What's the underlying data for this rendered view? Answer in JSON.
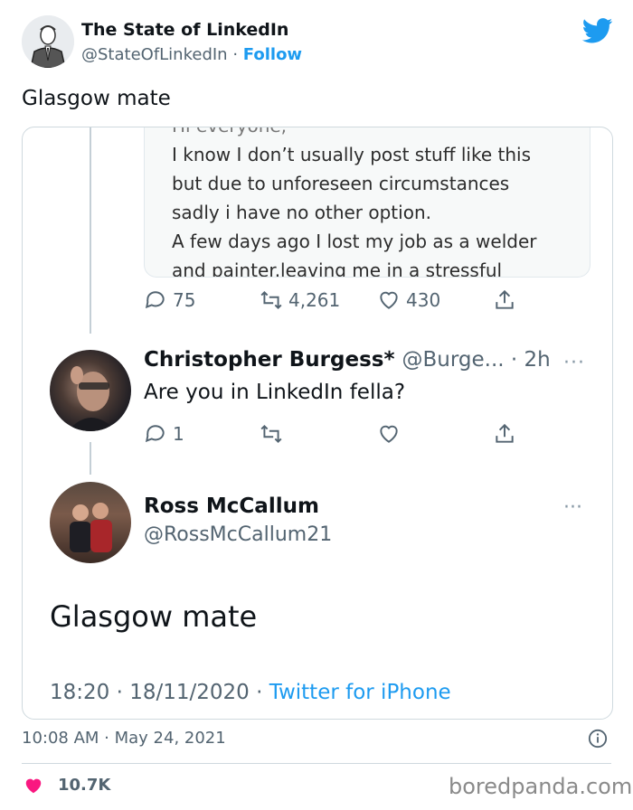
{
  "author": {
    "name": "The State of LinkedIn",
    "handle": "@StateOfLinkedIn",
    "separator": "·",
    "follow_label": "Follow"
  },
  "tweet_text": "Glasgow mate",
  "embedded": {
    "quoted_lines": [
      "I know I don’t usually post stuff like this",
      "but due to unforeseen circumstances",
      "sadly i have no other option.",
      "A few days ago I lost my job as a welder",
      "and painter.leaving me in a stressful"
    ],
    "quoted_actions": {
      "replies": "75",
      "retweets": "4,261",
      "likes": "430"
    },
    "reply1": {
      "name": "Christopher Burgess*",
      "meta": "@Burge... · 2h",
      "text": "Are you in LinkedIn fella?",
      "replies": "1",
      "dots": "···"
    },
    "reply2": {
      "name": "Ross McCallum",
      "handle": "@RossMcCallum21",
      "text": "Glasgow mate",
      "time": "18:20 · 18/11/2020 · ",
      "source": "Twitter for iPhone",
      "dots": "···"
    }
  },
  "timestamp": "10:08 AM · May 24, 2021",
  "likes_count": "10.7K",
  "watermark": "boredpanda.com",
  "colors": {
    "accent": "#1d9bf0",
    "heart": "#f91880"
  }
}
